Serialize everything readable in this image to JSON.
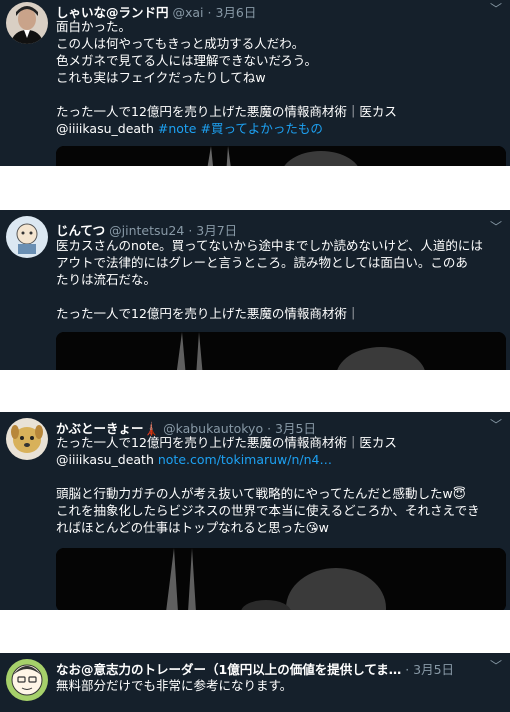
{
  "tweets": [
    {
      "name": "しゃいな@ランド円",
      "handle": "@xai",
      "date": "3月6日",
      "lines": [
        "面白かった。",
        "この人は何やってもきっと成功する人だわ。",
        "色メガネで見てる人には理解できないだろう。",
        "これも実はフェイクだったりしてねw",
        "",
        "たった一人で12億円を売り上げた悪魔の情報商材術｜医カス"
      ],
      "mention": "@iiiikasu_death",
      "hashtags": "#note #買ってよかったもの"
    },
    {
      "name": "じんてつ",
      "handle": "@jintetsu24",
      "date": "3月7日",
      "lines": [
        "医カスさんのnote。買ってないから途中までしか読めないけど、人道的には",
        "アウトで法律的にはグレーと言うところ。読み物としては面白い。このあ",
        "たりは流石だな。",
        "",
        "たった一人で12億円を売り上げた悪魔の情報商材術｜"
      ]
    },
    {
      "name": "かぶとーきょー🗼",
      "handle": "@kabukautokyo",
      "date": "3月5日",
      "lines_top": [
        "たった一人で12億円を売り上げた悪魔の情報商材術｜医カス"
      ],
      "mention": "@iiiikasu_death",
      "url": "note.com/tokimaruw/n/n4…",
      "lines_bottom": [
        "頭脳と行動力ガチの人が考え抜いて戦略的にやってたんだと感動したw😇",
        "これを抽象化したらビジネスの世界で本当に使えるどころか、それさえでき",
        "ればほとんどの仕事はトップなれると思った😘w"
      ]
    },
    {
      "name": "なお@意志力のトレーダー（1億円以上の価値を提供してま…",
      "date": "3月5日",
      "lines": [
        "無料部分だけでも非常に参考になります。"
      ]
    }
  ],
  "colors": {
    "bg": "#15202b",
    "link": "#1da1f2",
    "muted": "#8899a6"
  }
}
